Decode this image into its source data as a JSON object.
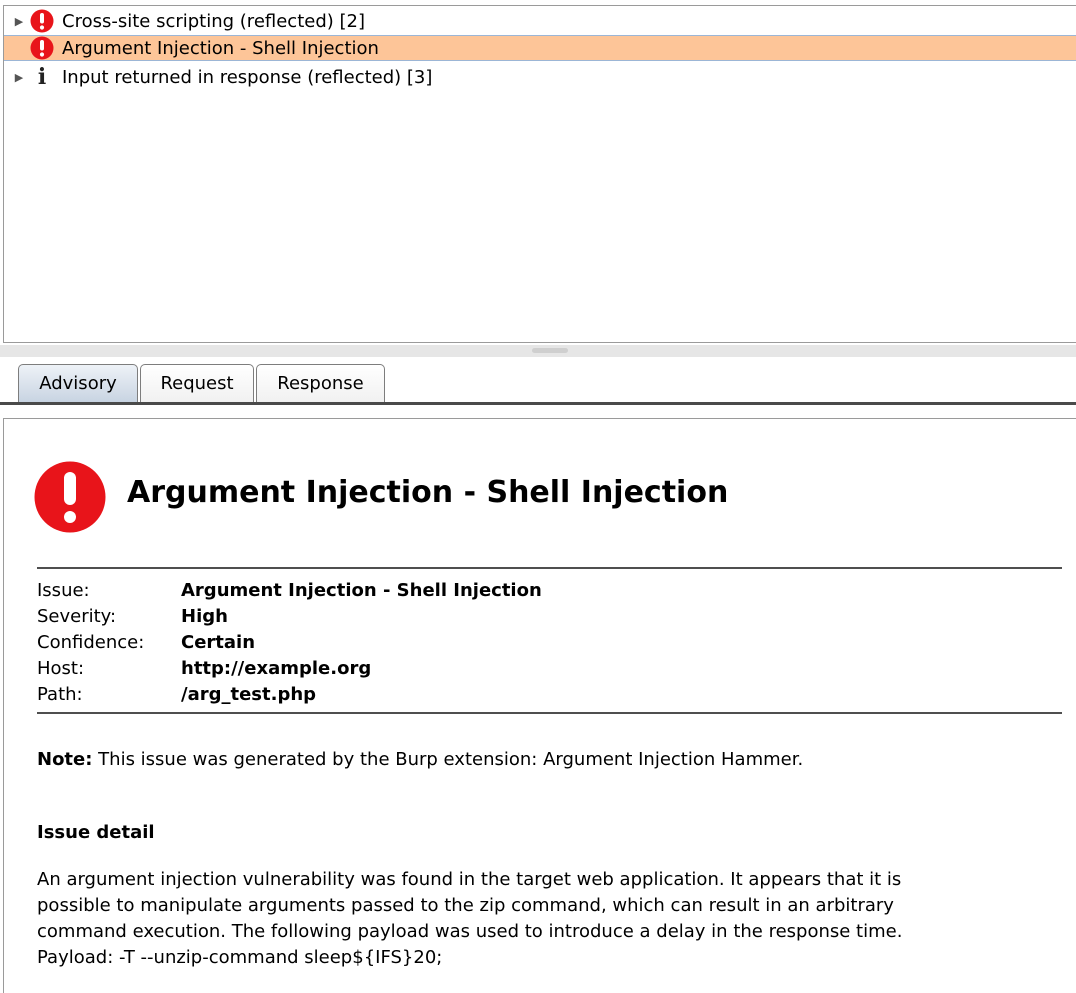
{
  "issues_tree": {
    "items": [
      {
        "label": "Cross-site scripting (reflected) [2]",
        "icon": "error-icon",
        "expandable": true,
        "selected": false
      },
      {
        "label": "Argument Injection - Shell Injection",
        "icon": "error-icon",
        "expandable": false,
        "selected": true
      },
      {
        "label": "Input returned in response (reflected) [3]",
        "icon": "info-icon",
        "expandable": true,
        "selected": false
      }
    ],
    "info_glyph": "i",
    "expand_glyph": "▶"
  },
  "tabs": [
    {
      "label": "Advisory",
      "active": true
    },
    {
      "label": "Request",
      "active": false
    },
    {
      "label": "Response",
      "active": false
    }
  ],
  "advisory": {
    "title": "Argument Injection - Shell Injection",
    "fields": [
      {
        "label": "Issue:",
        "value": "Argument Injection - Shell Injection"
      },
      {
        "label": "Severity:",
        "value": "High"
      },
      {
        "label": "Confidence:",
        "value": "Certain"
      },
      {
        "label": "Host:",
        "value": "http://example.org"
      },
      {
        "label": "Path:",
        "value": "/arg_test.php"
      }
    ],
    "note_label": "Note:",
    "note_text": " This issue was generated by the Burp extension: Argument Injection Hammer.",
    "detail_heading": "Issue detail",
    "detail_lines": [
      "An argument injection vulnerability was found in the target web application. It appears that it is",
      "possible to manipulate arguments passed to the zip command, which can result in an arbitrary",
      "command execution. The following payload was used to introduce a delay in the response time.",
      "Payload: -T --unzip-command sleep${IFS}20;"
    ]
  },
  "colors": {
    "selected_row": "#fdc598",
    "error_red": "#e8141a",
    "active_tab": "#c8d4e2"
  }
}
